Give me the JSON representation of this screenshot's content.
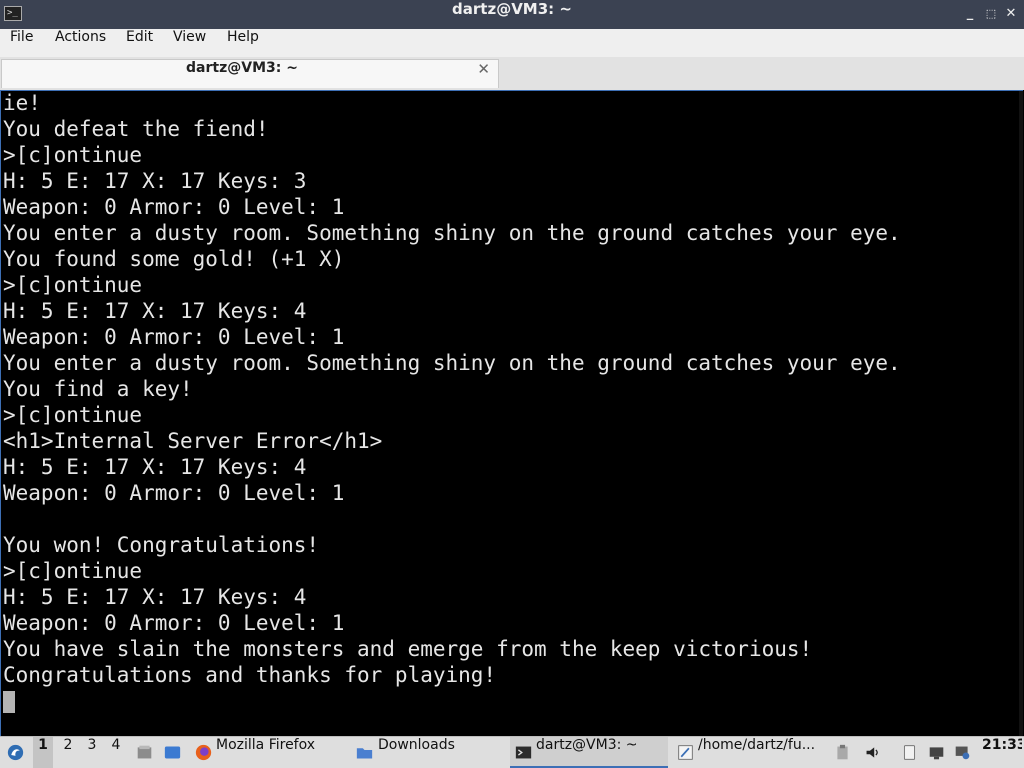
{
  "window": {
    "title": "dartz@VM3: ~",
    "app_icon": "terminal-icon",
    "controls": {
      "minimize": "_",
      "maximize": "⬚",
      "close": "✕"
    }
  },
  "menu": [
    "File",
    "Actions",
    "Edit",
    "View",
    "Help"
  ],
  "tab": {
    "label": "dartz@VM3: ~",
    "close": "✕"
  },
  "terminal": {
    "lines": [
      "ie!",
      "You defeat the fiend!",
      ">[c]ontinue",
      "H: 5 E: 17 X: 17 Keys: 3",
      "Weapon: 0 Armor: 0 Level: 1",
      "You enter a dusty room. Something shiny on the ground catches your eye.",
      "You found some gold! (+1 X)",
      ">[c]ontinue",
      "H: 5 E: 17 X: 17 Keys: 4",
      "Weapon: 0 Armor: 0 Level: 1",
      "You enter a dusty room. Something shiny on the ground catches your eye.",
      "You find a key!",
      ">[c]ontinue",
      "<h1>Internal Server Error</h1>",
      "H: 5 E: 17 X: 17 Keys: 4",
      "Weapon: 0 Armor: 0 Level: 1",
      "",
      "You won! Congratulations!",
      ">[c]ontinue",
      "H: 5 E: 17 X: 17 Keys: 4",
      "Weapon: 0 Armor: 0 Level: 1",
      "You have slain the monsters and emerge from the keep victorious!",
      "Congratulations and thanks for playing!"
    ]
  },
  "taskbar": {
    "workspaces": [
      "1",
      "2",
      "3",
      "4"
    ],
    "active_workspace": "1",
    "tasks": [
      {
        "label": "Mozilla Firefox",
        "icon": "firefox-icon"
      },
      {
        "label": "Downloads",
        "icon": "folder-icon"
      },
      {
        "label": "dartz@VM3: ~",
        "icon": "terminal-icon"
      },
      {
        "label": "/home/dartz/fu...",
        "icon": "text-editor-icon"
      }
    ],
    "tray_icons": [
      "clipboard-icon",
      "volume-icon",
      "removable-media-icon",
      "network-icon",
      "update-icon"
    ],
    "clock": "21:33"
  },
  "colors": {
    "titlebar": "#3b4252",
    "terminal_bg": "#000000",
    "terminal_fg": "#e6e6e6",
    "accent": "#3d6fb5",
    "taskbar": "#dedede"
  }
}
